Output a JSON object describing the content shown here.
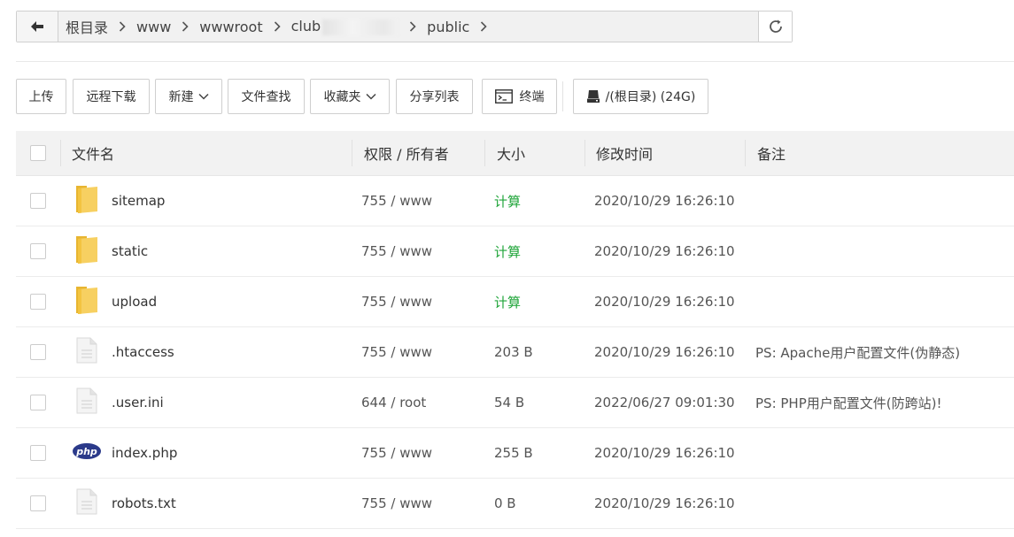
{
  "path": {
    "crumbs": [
      "根目录",
      "www",
      "wwwroot",
      "club",
      "public"
    ],
    "icons": {
      "back": "arrow-left-icon",
      "separator": "chevron-right-icon",
      "refresh": "refresh-icon"
    }
  },
  "toolbar": {
    "upload": "上传",
    "remote_download": "远程下载",
    "new": "新建",
    "file_search": "文件查找",
    "favorites": "收藏夹",
    "share_list": "分享列表",
    "terminal": "终端",
    "disk": "/(根目录) (24G)"
  },
  "table": {
    "headers": {
      "name": "文件名",
      "perm": "权限 / 所有者",
      "size": "大小",
      "mtime": "修改时间",
      "note": "备注"
    },
    "rows": [
      {
        "type": "folder",
        "icon": "folder-icon",
        "name": "sitemap",
        "perm": "755 / www",
        "size": "计算",
        "mtime": "2020/10/29 16:26:10",
        "note": ""
      },
      {
        "type": "folder",
        "icon": "folder-icon",
        "name": "static",
        "perm": "755 / www",
        "size": "计算",
        "mtime": "2020/10/29 16:26:10",
        "note": ""
      },
      {
        "type": "folder",
        "icon": "folder-icon",
        "name": "upload",
        "perm": "755 / www",
        "size": "计算",
        "mtime": "2020/10/29 16:26:10",
        "note": ""
      },
      {
        "type": "file",
        "icon": "file-icon",
        "name": ".htaccess",
        "perm": "755 / www",
        "size": "203 B",
        "mtime": "2020/10/29 16:26:10",
        "note": "PS: Apache用户配置文件(伪静态)"
      },
      {
        "type": "file",
        "icon": "file-icon",
        "name": ".user.ini",
        "perm": "644 / root",
        "size": "54 B",
        "mtime": "2022/06/27 09:01:30",
        "note": "PS: PHP用户配置文件(防跨站)!"
      },
      {
        "type": "php",
        "icon": "php-icon",
        "php_label": "php",
        "name": "index.php",
        "perm": "755 / www",
        "size": "255 B",
        "mtime": "2020/10/29 16:26:10",
        "note": ""
      },
      {
        "type": "file",
        "icon": "file-icon",
        "name": "robots.txt",
        "perm": "755 / www",
        "size": "0 B",
        "mtime": "2020/10/29 16:26:10",
        "note": ""
      }
    ]
  },
  "colors": {
    "calc_green": "#20a53a",
    "folder_yellow": "#f7d061",
    "php_blue": "#2b3a8a",
    "header_bg": "#f2f2f2"
  }
}
